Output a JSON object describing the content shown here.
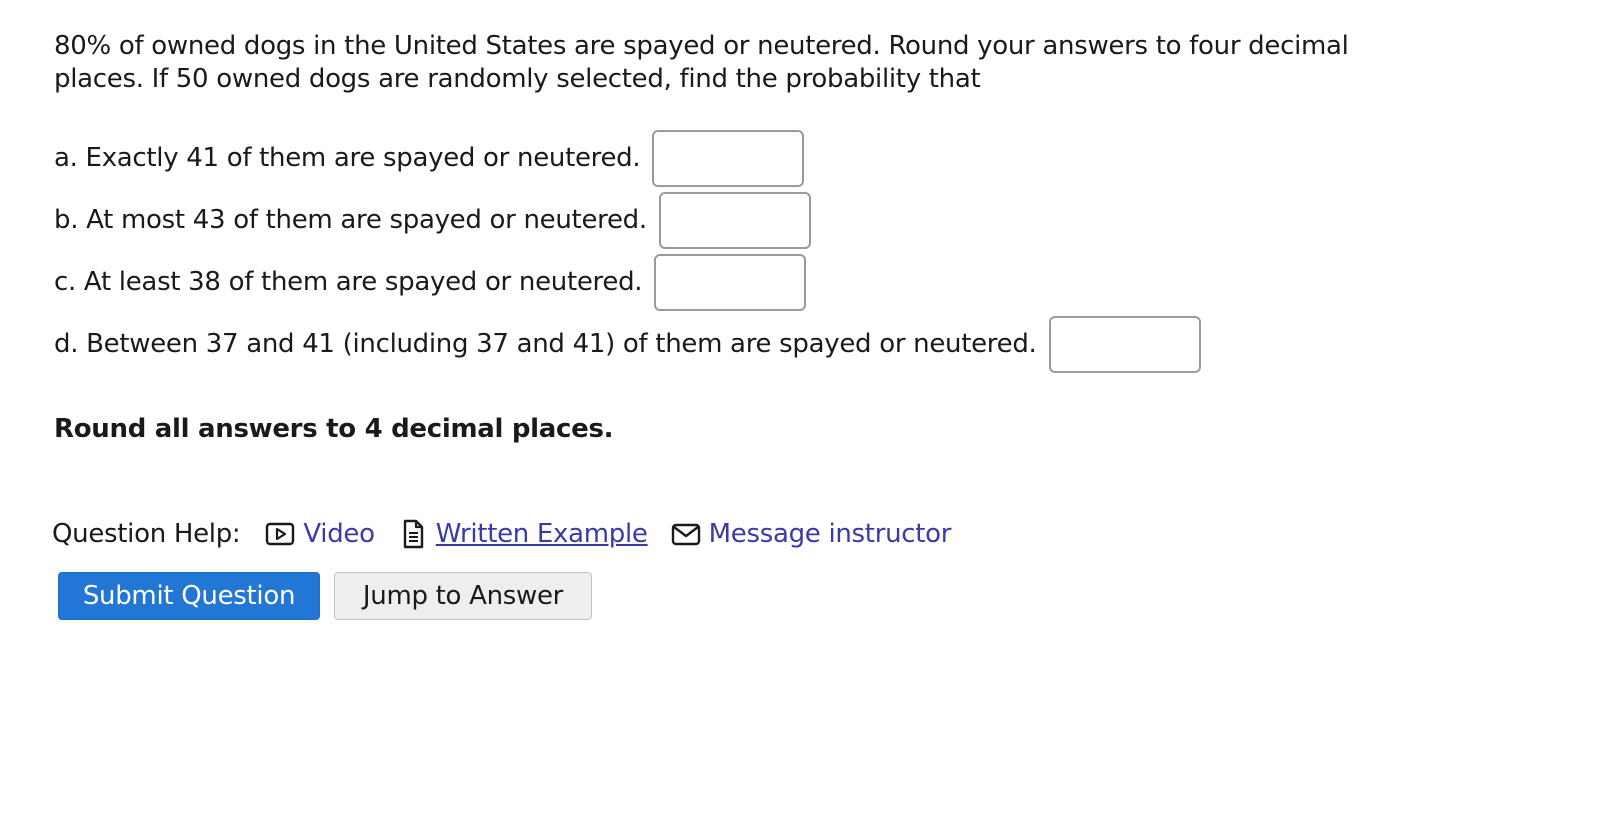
{
  "question": {
    "intro": "80% of owned dogs in the United States are spayed or neutered. Round your answers to four decimal places. If 50 owned dogs are randomly selected, find the probability that",
    "parts": [
      {
        "label": "a. Exactly 41 of them are spayed or neutered.",
        "value": ""
      },
      {
        "label": "b. At most 43 of them are spayed or neutered.",
        "value": ""
      },
      {
        "label": "c. At least 38 of them are spayed or neutered.",
        "value": ""
      },
      {
        "label": "d. Between 37 and 41 (including 37 and 41) of them are spayed or neutered.",
        "value": ""
      }
    ],
    "round_note": "Round all answers to 4 decimal places."
  },
  "help": {
    "label": "Question Help:",
    "video": {
      "label": "Video",
      "icon": "video-icon"
    },
    "written_example": {
      "label": "Written Example",
      "icon": "document-icon"
    },
    "message": {
      "label": "Message instructor",
      "icon": "envelope-icon"
    }
  },
  "buttons": {
    "submit": "Submit Question",
    "jump": "Jump to Answer"
  },
  "colors": {
    "link": "#3a3aa8",
    "primary": "#2176d6",
    "secondary_bg": "#eeeeee",
    "input_border": "#9a9a9a"
  }
}
